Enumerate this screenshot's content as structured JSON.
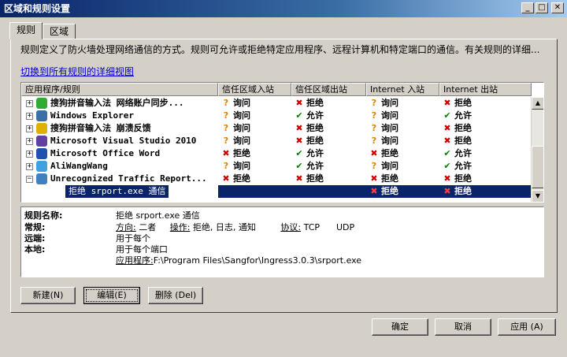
{
  "window": {
    "title": "区域和规则设置",
    "controls": [
      "_",
      "□",
      "✕"
    ]
  },
  "tabs": [
    {
      "label": "规则",
      "active": true
    },
    {
      "label": "区域",
      "active": false
    }
  ],
  "description": "规则定义了防火墙处理网络通信的方式。规则可允许或拒绝特定应用程序、远程计算机和特定端口的通信。有关规则的详细...",
  "switch_link": "切换到所有规则的详细视图",
  "columns": [
    "应用程序/规则",
    "信任区域入站",
    "信任区域出站",
    "Internet 入站",
    "Internet 出站"
  ],
  "status_labels": {
    "ask": "询问",
    "allow": "允许",
    "deny": "拒绝"
  },
  "rows": [
    {
      "expander": "+",
      "icon": "sogou-input-icon",
      "icon_color": "#33aa33",
      "name": "搜狗拼音输入法 网络账户同步...",
      "values": [
        "ask",
        "deny",
        "ask",
        "deny"
      ]
    },
    {
      "expander": "+",
      "icon": "windows-explorer-icon",
      "icon_color": "#3a6ea5",
      "name": "Windows Explorer",
      "values": [
        "ask",
        "allow",
        "ask",
        "allow"
      ]
    },
    {
      "expander": "+",
      "icon": "sogou-crash-icon",
      "icon_color": "#e0b000",
      "name": "搜狗拼音输入法 崩溃反馈",
      "values": [
        "ask",
        "deny",
        "ask",
        "deny"
      ]
    },
    {
      "expander": "+",
      "icon": "visual-studio-icon",
      "icon_color": "#6040a0",
      "name": "Microsoft Visual Studio 2010",
      "values": [
        "ask",
        "deny",
        "ask",
        "deny"
      ]
    },
    {
      "expander": "+",
      "icon": "word-icon",
      "icon_color": "#2050b0",
      "name": "Microsoft Office Word",
      "values": [
        "deny",
        "allow",
        "deny",
        "allow"
      ]
    },
    {
      "expander": "+",
      "icon": "aliwangwang-icon",
      "icon_color": "#40a0e0",
      "name": "AliWangWang",
      "values": [
        "ask",
        "allow",
        "ask",
        "allow"
      ]
    },
    {
      "expander": "−",
      "icon": "unrecognized-traffic-icon",
      "icon_color": "#4080c0",
      "name": "Unrecognized Traffic Report...",
      "values": [
        "deny",
        "deny",
        "deny",
        "deny"
      ]
    }
  ],
  "selected_row": {
    "name": "拒绝 srport.exe 通信",
    "values": [
      "",
      "",
      "deny",
      "deny"
    ]
  },
  "details": {
    "rule_name_label": "规则名称:",
    "rule_name": "拒绝 srport.exe 通信",
    "general_label": "常规:",
    "direction_label": "方向:",
    "direction_value": "二者",
    "action_label": "操作:",
    "action_value": "拒绝, 日志, 通知",
    "protocol_label": "协议:",
    "protocol_value": "TCP",
    "protocol_value2": "UDP",
    "remote_label": "远端:",
    "remote_value": "用于每个",
    "local_label": "本地:",
    "local_value": "用于每个端口",
    "app_label": "应用程序:",
    "app_value": "F:\\Program Files\\Sangfor\\Ingress3.0.3\\srport.exe"
  },
  "buttons": {
    "new": "新建(N)",
    "edit": "编辑(E)",
    "delete": "删除 (Del)",
    "ok": "确定",
    "cancel": "取消",
    "apply": "应用 (A)"
  }
}
